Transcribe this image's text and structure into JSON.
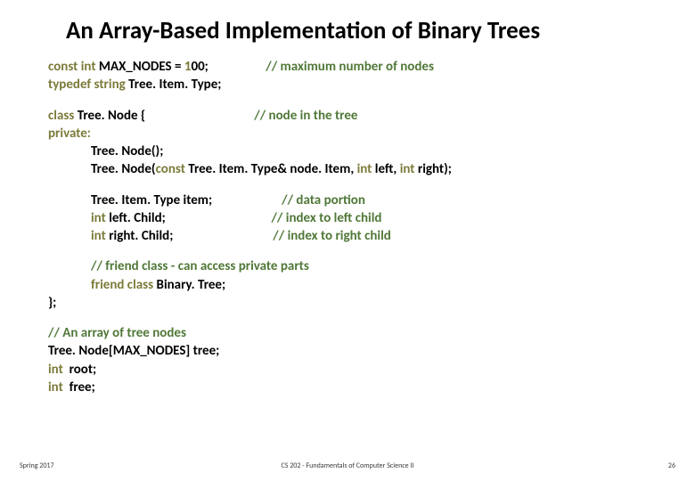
{
  "title": "An Array-Based Implementation of Binary Trees",
  "code": {
    "b1l1a": "const int",
    "b1l1b": " MAX_NODES = ",
    "b1l1c": "1",
    "b1l1d": "00;",
    "b1l1e": "                   // maximum number of nodes",
    "b1l2a": "typedef string ",
    "b1l2b": "Tree. Item. Type",
    "b1l2c": ";",
    "b2l1a": "class ",
    "b2l1b": "Tree. Node",
    "b2l1c": " {",
    "b2l1d": "                                    // node in the tree",
    "b2l2": "private:",
    "b2l3a": "Tree. Node",
    "b2l3b": "();",
    "b2l4a": "Tree. Node",
    "b2l4b": "(",
    "b2l4c": "const ",
    "b2l4d": "Tree. Item. Type",
    "b2l4e": "& ",
    "b2l4f": "node. Item",
    "b2l4g": ", ",
    "b2l4h": "int",
    "b2l4i": " left, ",
    "b2l4j": "int",
    "b2l4k": " right);",
    "b3l1a": "Tree. Item. Type",
    "b3l1b": " item;",
    "b3l1c": "                       // data portion",
    "b3l2a": "int ",
    "b3l2b": "left. Child",
    "b3l2c": ";",
    "b3l2d": "                                   // index to left child",
    "b3l3a": "int ",
    "b3l3b": "right. Child",
    "b3l3c": ";",
    "b3l3d": "                                 // index to right child",
    "b4l1": "// friend class - can access private parts",
    "b4l2a": "friend class ",
    "b4l2b": "Binary. Tree",
    "b4l2c": ";",
    "b4l3": "};",
    "b5l1": "// An array of tree nodes",
    "b5l2a": "Tree. Node",
    "b5l2b": "[MAX_NODES] tree;",
    "b5l3a": "int ",
    "b5l3b": " root;",
    "b5l4a": "int ",
    "b5l4b": " free;"
  },
  "footer": {
    "left": "Spring 2017",
    "center": "CS 202 - Fundamentals of Computer Science II",
    "page": "26"
  }
}
